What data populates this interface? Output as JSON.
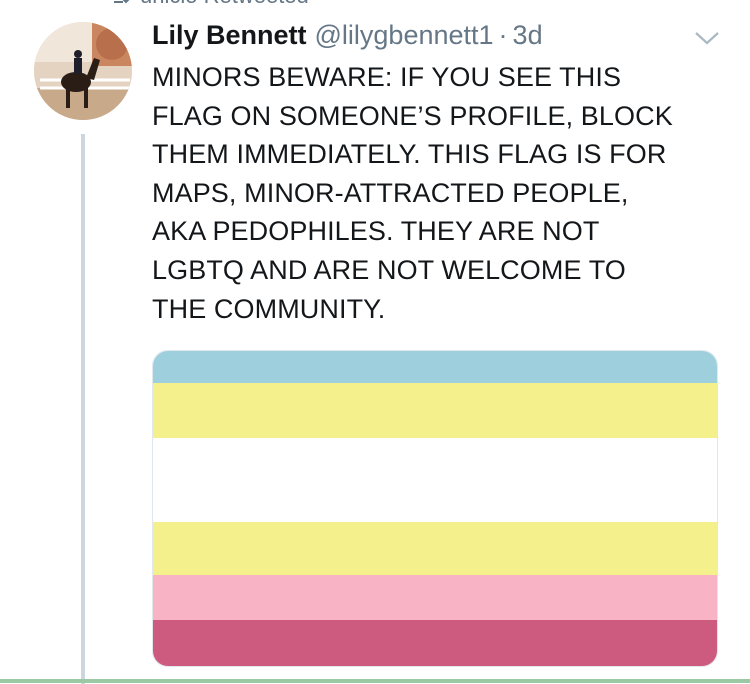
{
  "retweet_banner": {
    "icon": "retweet-icon",
    "text": "unicio Retweeted"
  },
  "tweet": {
    "author": {
      "display_name": "Lily Bennett",
      "handle": "@lilygbennett1",
      "separator": "·",
      "time": "3d",
      "avatar": "horse-rider-photo"
    },
    "menu_icon": "chevron-down-icon",
    "text_lines": [
      "MINORS BEWARE: IF YOU SEE THIS",
      "FLAG ON SOMEONE’S PROFILE, BLOCK",
      "THEM IMMEDIATELY. THIS FLAG IS FOR",
      "MAPS, MINOR-ATTRACTED PEOPLE,",
      "AKA PEDOPHILES. THEY ARE NOT",
      "LGBTQ AND ARE NOT WELCOME TO",
      "THE COMMUNITY."
    ],
    "media": {
      "description_kind": "flag-image",
      "stripes": [
        {
          "color": "#9ecfdc",
          "share": 0.103
        },
        {
          "color": "#f4f08c",
          "share": 0.172
        },
        {
          "color": "#ffffff",
          "share": 0.268
        },
        {
          "color": "#f4f08c",
          "share": 0.168
        },
        {
          "color": "#f8b4c4",
          "share": 0.143
        },
        {
          "color": "#cc5b7f",
          "share": 0.146
        }
      ]
    }
  },
  "colors": {
    "text": "#14171a",
    "secondary": "#657786",
    "thread_line": "#ccd6dd"
  }
}
